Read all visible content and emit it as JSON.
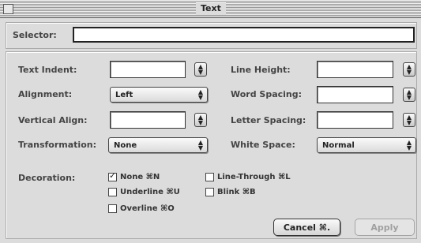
{
  "window": {
    "title": "Text"
  },
  "selector": {
    "label": "Selector:",
    "value": ""
  },
  "fields": {
    "text_indent": {
      "label": "Text Indent:",
      "value": ""
    },
    "alignment": {
      "label": "Alignment:",
      "value": "Left"
    },
    "vertical_align": {
      "label": "Vertical Align:",
      "value": ""
    },
    "transformation": {
      "label": "Transformation:",
      "value": "None"
    },
    "line_height": {
      "label": "Line Height:",
      "value": ""
    },
    "word_spacing": {
      "label": "Word Spacing:",
      "value": ""
    },
    "letter_spacing": {
      "label": "Letter Spacing:",
      "value": ""
    },
    "white_space": {
      "label": "White Space:",
      "value": "Normal"
    }
  },
  "decoration": {
    "label": "Decoration:",
    "options": [
      {
        "label": "None ⌘N",
        "checked": true
      },
      {
        "label": "Underline ⌘U",
        "checked": false
      },
      {
        "label": "Overline ⌘O",
        "checked": false
      },
      {
        "label": "Line-Through ⌘L",
        "checked": false
      },
      {
        "label": "Blink ⌘B",
        "checked": false
      }
    ]
  },
  "buttons": {
    "cancel": "Cancel ⌘.",
    "apply": "Apply"
  }
}
